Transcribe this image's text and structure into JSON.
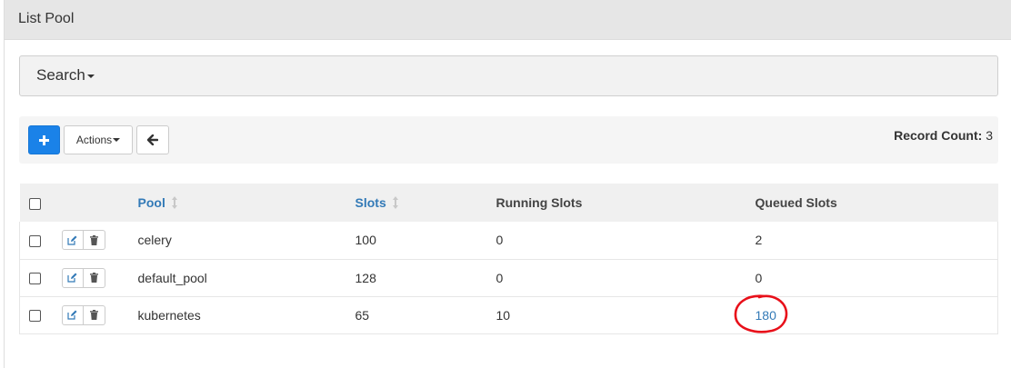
{
  "panel": {
    "title": "List Pool"
  },
  "search": {
    "label": "Search"
  },
  "toolbar": {
    "add_icon": "plus-icon",
    "actions_label": "Actions",
    "back_icon": "arrow-left-icon",
    "record_count_label": "Record Count:",
    "record_count_value": "3"
  },
  "table": {
    "columns": {
      "pool": "Pool",
      "slots": "Slots",
      "running": "Running Slots",
      "queued": "Queued Slots"
    },
    "rows": [
      {
        "pool": "celery",
        "slots": "100",
        "running": "0",
        "queued": "2"
      },
      {
        "pool": "default_pool",
        "slots": "128",
        "running": "0",
        "queued": "0"
      },
      {
        "pool": "kubernetes",
        "slots": "65",
        "running": "10",
        "queued": "180"
      }
    ]
  },
  "colors": {
    "primary": "#1a82e8",
    "link": "#337ab7",
    "annotation": "#e8101a"
  }
}
